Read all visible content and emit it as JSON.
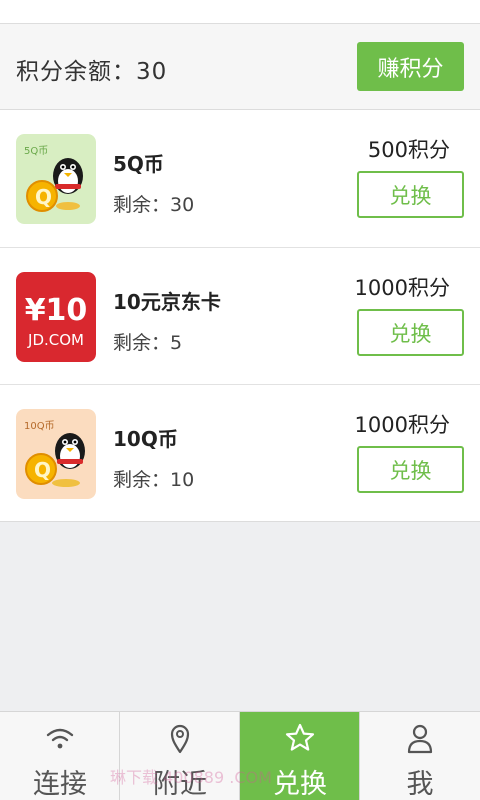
{
  "balance": {
    "text": "积分余额：30",
    "earn_button": "赚积分"
  },
  "items": [
    {
      "name": "5Q币",
      "remaining": "剩余：30",
      "price": "500积分",
      "button": "兑换",
      "thumb": {
        "label": "5Q币",
        "icon": "qq-penguin-coin-icon",
        "bg": "#d8eec2"
      }
    },
    {
      "name": "10元京东卡",
      "remaining": "剩余：5",
      "price": "1000积分",
      "button": "兑换",
      "thumb": {
        "big": "¥10",
        "small": "JD.COM",
        "icon": "jd-card-logo",
        "bg": "#d9282f"
      }
    },
    {
      "name": "10Q币",
      "remaining": "剩余：10",
      "price": "1000积分",
      "button": "兑换",
      "thumb": {
        "label": "10Q币",
        "icon": "qq-penguin-coin-icon",
        "bg": "#fbdcbf"
      }
    }
  ],
  "tabs": [
    {
      "label": "连接",
      "icon": "wifi-icon",
      "active": false
    },
    {
      "label": "附近",
      "icon": "location-pin-icon",
      "active": false
    },
    {
      "label": "兑换",
      "icon": "star-icon",
      "active": true
    },
    {
      "label": "我",
      "icon": "user-icon",
      "active": false
    }
  ],
  "watermark": "琳下载 400889 .COM",
  "colors": {
    "accent": "#6fbe4a",
    "jd_red": "#d9282f"
  }
}
